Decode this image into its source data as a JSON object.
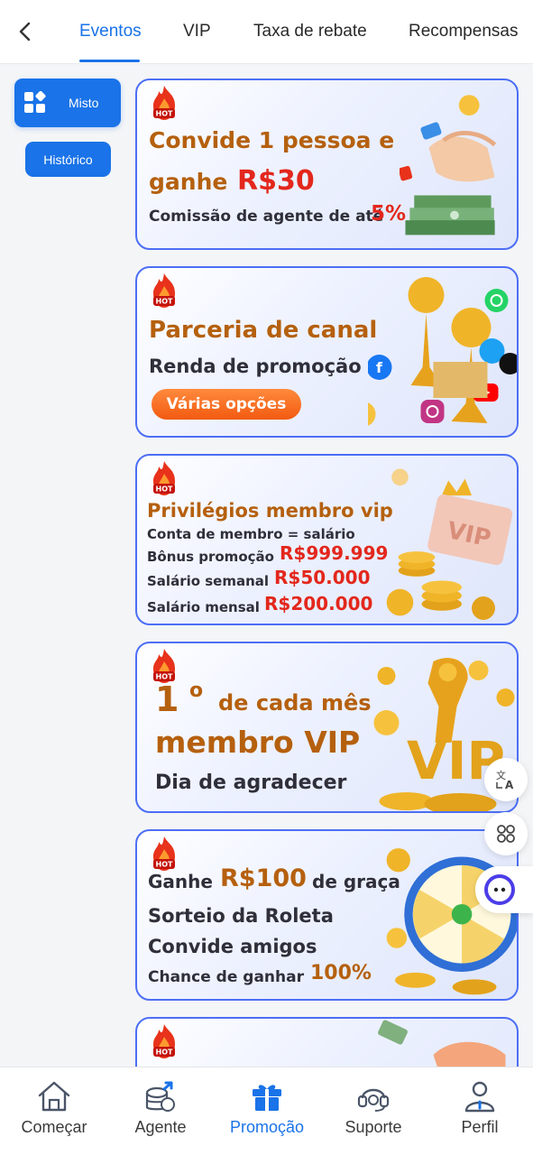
{
  "header": {
    "tabs": [
      {
        "label": "Eventos",
        "active": true
      },
      {
        "label": "VIP",
        "active": false
      },
      {
        "label": "Taxa de rebate",
        "active": false
      },
      {
        "label": "Recompensas",
        "active": false
      }
    ]
  },
  "sidebar": {
    "items": [
      {
        "label": "Misto",
        "icon": "grid-icon",
        "active": true
      },
      {
        "label": "Histórico",
        "active": false
      }
    ]
  },
  "banners": [
    {
      "badge": "HOT",
      "line1": "Convide 1 pessoa e",
      "line2_prefix": "ganhe",
      "line2_amount": "R$30",
      "line3_prefix": "Comissão de agente de até",
      "line3_value": "5%"
    },
    {
      "badge": "HOT",
      "title": "Parceria de canal",
      "subtitle": "Renda de promoção",
      "button": "Várias opções"
    },
    {
      "badge": "HOT",
      "title": "Privilégios membro vip",
      "line1": "Conta de membro = salário",
      "line2_label": "Bônus promoção",
      "line2_value": "R$999.999",
      "line3_label": "Salário semanal",
      "line3_value": "R$50.000",
      "line4_label": "Salário mensal",
      "line4_value": "R$200.000",
      "art_text": "VIP"
    },
    {
      "badge": "HOT",
      "day": "1",
      "ordinal": "o",
      "line1": "de cada mês",
      "line2": "membro VIP",
      "line3": "Dia de agradecer",
      "art_text": "VIP"
    },
    {
      "badge": "HOT",
      "line1_prefix": "Ganhe",
      "line1_amount": "R$100",
      "line1_suffix": "de graça",
      "line2": "Sorteio da Roleta",
      "line3": "Convide amigos",
      "line4_prefix": "Chance de ganhar",
      "line4_value": "100%"
    },
    {
      "badge": "HOT"
    }
  ],
  "floating": [
    "translate-icon",
    "apps-icon",
    "chatbot-icon"
  ],
  "bottom_nav": [
    {
      "label": "Começar",
      "icon": "home-icon",
      "active": false
    },
    {
      "label": "Agente",
      "icon": "agent-icon",
      "active": false
    },
    {
      "label": "Promoção",
      "icon": "gift-icon",
      "active": true
    },
    {
      "label": "Suporte",
      "icon": "headset-icon",
      "active": false
    },
    {
      "label": "Perfil",
      "icon": "user-icon",
      "active": false
    }
  ],
  "colors": {
    "accent": "#1a73e8",
    "banner_border": "#4c6ef5",
    "title_brown": "#b5600e",
    "highlight_red": "#e3271c",
    "button_orange": "#f25a10"
  }
}
